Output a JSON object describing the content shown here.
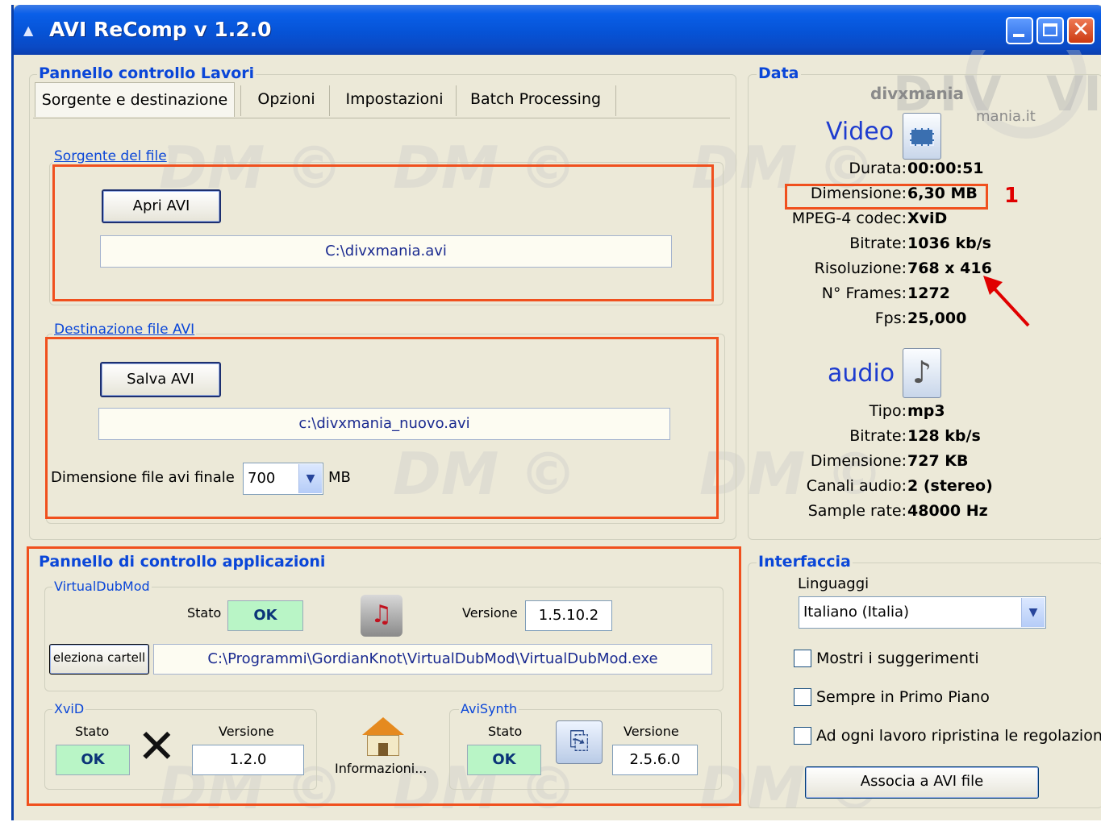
{
  "window": {
    "title": "AVI ReComp  v 1.2.0"
  },
  "jobs_panel": {
    "title": "Pannello controllo Lavori",
    "tabs": [
      "Sorgente e destinazione",
      "Opzioni",
      "Impostazioni",
      "Batch Processing"
    ],
    "source": {
      "title": "Sorgente del file",
      "button": "Apri AVI",
      "path": "C:\\divxmania.avi"
    },
    "destination": {
      "title": "Destinazione file AVI",
      "button": "Salva AVI",
      "path": "c:\\divxmania_nuovo.avi",
      "size_label": "Dimensione file avi finale",
      "size_value": "700",
      "size_unit": "MB"
    }
  },
  "data_panel": {
    "title": "Data",
    "logo_text": "divxmania",
    "logo_sub": "mania.it",
    "video": {
      "heading": "Video",
      "rows": [
        {
          "key": "Durata:",
          "value": "00:00:51"
        },
        {
          "key": "Dimensione:",
          "value": "6,30 MB"
        },
        {
          "key": "MPEG-4 codec:",
          "value": "XviD"
        },
        {
          "key": "Bitrate:",
          "value": "1036 kb/s"
        },
        {
          "key": "Risoluzione:",
          "value": "768 x 416"
        },
        {
          "key": "N° Frames:",
          "value": "1272"
        },
        {
          "key": "Fps:",
          "value": "25,000"
        }
      ],
      "annotation": "1"
    },
    "audio": {
      "heading": "audio",
      "rows": [
        {
          "key": "Tipo:",
          "value": "mp3"
        },
        {
          "key": "Bitrate:",
          "value": "128 kb/s"
        },
        {
          "key": "Dimensione:",
          "value": "727 KB"
        },
        {
          "key": "Canali audio:",
          "value": "2 (stereo)"
        },
        {
          "key": "Sample rate:",
          "value": "48000 Hz"
        }
      ]
    }
  },
  "apps_panel": {
    "title": "Pannello di controllo applicazioni",
    "vdm": {
      "title": "VirtualDubMod",
      "stato_label": "Stato",
      "stato": "OK",
      "versione_label": "Versione",
      "versione": "1.5.10.2",
      "select_button": "eleziona cartell",
      "path": "C:\\Programmi\\GordianKnot\\VirtualDubMod\\VirtualDubMod.exe"
    },
    "xvid": {
      "title": "XviD",
      "stato_label": "Stato",
      "stato": "OK",
      "versione_label": "Versione",
      "versione": "1.2.0"
    },
    "info_label": "Informazioni...",
    "avisynth": {
      "title": "AviSynth",
      "stato_label": "Stato",
      "stato": "OK",
      "versione_label": "Versione",
      "versione": "2.5.6.0"
    }
  },
  "interface_panel": {
    "title": "Interfaccia",
    "language_label": "Linguaggi",
    "language_value": "Italiano (Italia)",
    "checkboxes": [
      "Mostri i suggerimenti",
      "Sempre in Primo Piano",
      "Ad ogni lavoro ripristina le regolazioni"
    ],
    "associate_button": "Associa a AVI file"
  },
  "watermark": "DM ©",
  "colors": {
    "accent": "#0a46d8",
    "highlight": "#f0501e",
    "ok_bg": "#b9f5c6"
  }
}
